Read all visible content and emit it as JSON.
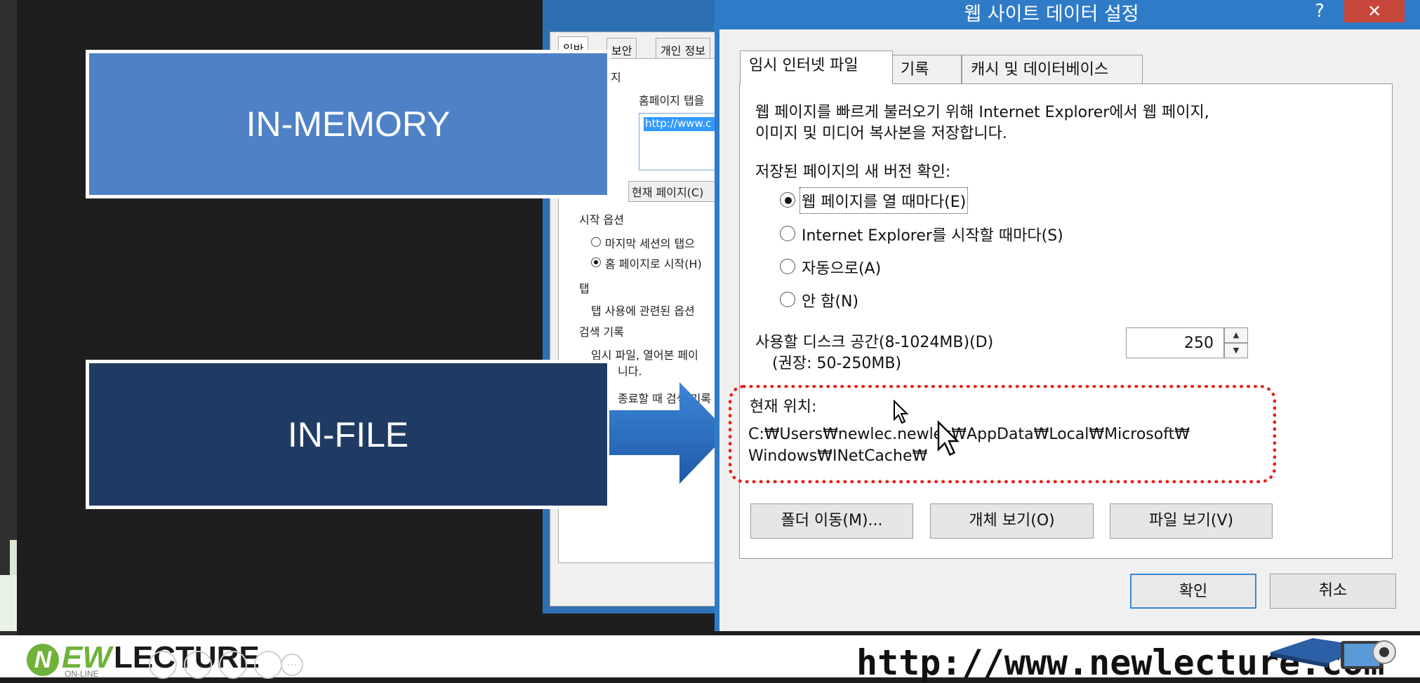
{
  "slide": {
    "box_top": "IN-MEMORY",
    "box_bottom": "IN-FILE"
  },
  "background_window": {
    "tabs": [
      "일반",
      "보안",
      "개인 정보"
    ],
    "section_home": "지",
    "home_tabs_label": "홈페이지 탭을",
    "url_value": "http://www.c",
    "current_page_button": "현재 페이지(C)",
    "start_options_title": "시작 옵션",
    "start_option_last": "마지막 세션의 탭으",
    "start_option_home": "홈 페이지로 시작(H)",
    "tabs_title": "탭",
    "tabs_desc": "탭 사용에 관련된 옵션",
    "history_title": "검색 기록",
    "history_desc_1": "임시 파일, 열어본 페이",
    "history_desc_2": "니다.",
    "history_desc_3": "종료할 때 검색 기록"
  },
  "dialog": {
    "title": "웹 사이트 데이터 설정",
    "help": "?",
    "close": "✕",
    "tabs": [
      "임시 인터넷 파일",
      "기록",
      "캐시 및 데이터베이스"
    ],
    "description_1": "웹 페이지를 빠르게 불러오기 위해 Internet Explorer에서 웹 페이지,",
    "description_2": "이미지 및 미디어 복사본을 저장합니다.",
    "check_label": "저장된 페이지의 새 버전 확인:",
    "radio_options": [
      {
        "label": "웹 페이지를 열 때마다(E)",
        "selected": true
      },
      {
        "label": "Internet Explorer를 시작할 때마다(S)",
        "selected": false
      },
      {
        "label": "자동으로(A)",
        "selected": false
      },
      {
        "label": "안 함(N)",
        "selected": false
      }
    ],
    "disk_label": "사용할 디스크 공간(8-1024MB)(D)",
    "disk_recommend": "(권장: 50-250MB)",
    "disk_value": "250",
    "location_label": "현재 위치:",
    "location_path_1": "C:₩Users₩newlec.newlec₩AppData₩Local₩Microsoft₩",
    "location_path_2": "Windows₩INetCache₩",
    "buttons": {
      "move_folder": "폴더 이동(M)...",
      "view_objects": "개체 보기(O)",
      "view_files": "파일 보기(V)",
      "ok": "확인",
      "cancel": "취소"
    }
  },
  "bottom_bar": {
    "logo_mark": "N",
    "logo_ew": "EW",
    "logo_lecture": "LECTURE",
    "logo_sub": "ON-LINE",
    "url": "http://www.newlecture.com"
  },
  "colors": {
    "memory_box": "#4f81c6",
    "file_box": "#1f3b63",
    "arrow": "#2f6fbf",
    "dialog_frame": "#2f7bc8",
    "highlight": "#e5241c",
    "logo_green": "#6fb23a"
  }
}
